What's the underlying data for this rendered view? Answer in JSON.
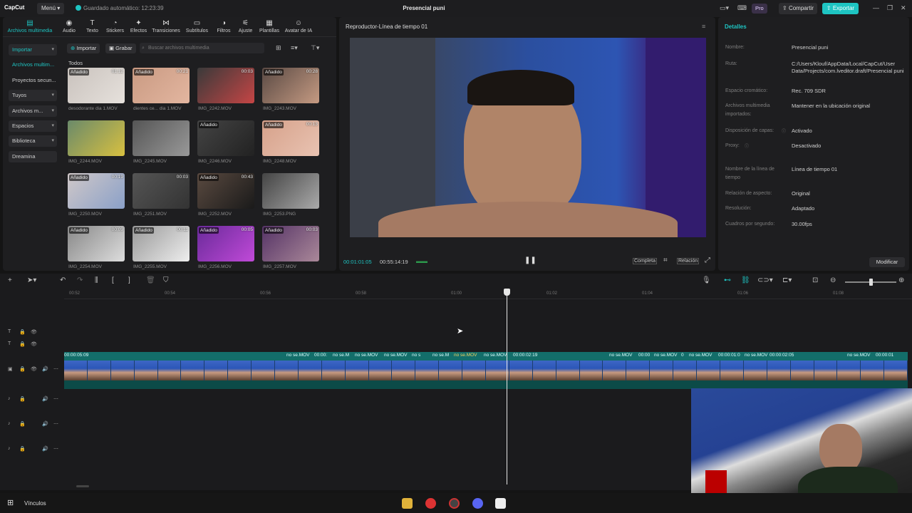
{
  "app": {
    "logo": "CapCut",
    "menu_label": "Menú",
    "autosave": "Guardado automático: 12:23:39",
    "project_title": "Presencial puni",
    "pro_label": "Pro",
    "share_label": "Compartir",
    "export_label": "Exportar"
  },
  "toolbar": {
    "tools": [
      {
        "label": "Archivos multimedia",
        "icon": "media-icon"
      },
      {
        "label": "Audio",
        "icon": "audio-icon"
      },
      {
        "label": "Texto",
        "icon": "text-icon"
      },
      {
        "label": "Stickers",
        "icon": "sticker-icon"
      },
      {
        "label": "Efectos",
        "icon": "effects-icon"
      },
      {
        "label": "Transiciones",
        "icon": "transitions-icon"
      },
      {
        "label": "Subtítulos",
        "icon": "subtitles-icon"
      },
      {
        "label": "Filtros",
        "icon": "filters-icon"
      },
      {
        "label": "Ajuste",
        "icon": "adjust-icon"
      },
      {
        "label": "Plantillas",
        "icon": "templates-icon"
      },
      {
        "label": "Avatar de IA",
        "icon": "ai-avatar-icon"
      }
    ]
  },
  "sidebar": {
    "items": [
      {
        "label": "Importar"
      },
      {
        "label": "Archivos multim..."
      },
      {
        "label": "Proyectos secun..."
      },
      {
        "label": "Tuyos"
      },
      {
        "label": "Archivos m..."
      },
      {
        "label": "Espacios"
      },
      {
        "label": "Biblioteca"
      },
      {
        "label": "Dreamina"
      }
    ]
  },
  "media": {
    "import_label": "Importar",
    "record_label": "Grabar",
    "search_placeholder": "Buscar archivos multimedia",
    "section_label": "Todos",
    "added_label": "Añadido",
    "items": [
      {
        "name": "desodorante dia 1.MOV",
        "duration": "01:12",
        "added": true
      },
      {
        "name": "dientes ce... dia 1.MOV",
        "duration": "00:21",
        "added": true
      },
      {
        "name": "IMG_2242.MOV",
        "duration": "00:03",
        "added": false
      },
      {
        "name": "IMG_2243.MOV",
        "duration": "00:28",
        "added": true
      },
      {
        "name": "IMG_2244.MOV",
        "duration": "",
        "added": false
      },
      {
        "name": "IMG_2245.MOV",
        "duration": "",
        "added": false
      },
      {
        "name": "IMG_2246.MOV",
        "duration": "",
        "added": true
      },
      {
        "name": "IMG_2248.MOV",
        "duration": "00:13",
        "added": true
      },
      {
        "name": "IMG_2250.MOV",
        "duration": "00:19",
        "added": true
      },
      {
        "name": "IMG_2251.MOV",
        "duration": "00:03",
        "added": false
      },
      {
        "name": "IMG_2252.MOV",
        "duration": "00:43",
        "added": true
      },
      {
        "name": "IMG_2253.PNG",
        "duration": "",
        "added": false
      },
      {
        "name": "IMG_2254.MOV",
        "duration": "00:09",
        "added": true
      },
      {
        "name": "IMG_2255.MOV",
        "duration": "00:11",
        "added": true
      },
      {
        "name": "IMG_2256.MOV",
        "duration": "00:05",
        "added": true
      },
      {
        "name": "IMG_2257.MOV",
        "duration": "00:03",
        "added": true
      }
    ]
  },
  "player": {
    "title": "Reproductor-Línea de tiempo 01",
    "current_time": "00:01:01:05",
    "total_time": "00:55:14:19",
    "full_label": "Completa",
    "ratio_label": "Relación"
  },
  "details": {
    "header": "Detalles",
    "rows": [
      {
        "label": "Nombre:",
        "value": "Presencial puni"
      },
      {
        "label": "Ruta:",
        "value": "C:/Users/Klouf/AppData/Local/CapCut/User Data/Projects/com.lveditor.draft/Presencial puni"
      },
      {
        "label": "Espacio cromático:",
        "value": "Rec. 709 SDR"
      },
      {
        "label": "Archivos multimedia importados:",
        "value": "Mantener en la ubicación original"
      },
      {
        "label": "Disposición de capas:",
        "value": "Activado"
      },
      {
        "label": "Proxy:",
        "value": "Desactivado"
      },
      {
        "label": "Nombre de la línea de tiempo",
        "value": "Línea de tiempo 01"
      },
      {
        "label": "Relación de aspecto:",
        "value": "Original"
      },
      {
        "label": "Resolución:",
        "value": "Adaptado"
      },
      {
        "label": "Cuadros por segundo:",
        "value": "30.00fps"
      }
    ],
    "modify_label": "Modificar"
  },
  "timeline": {
    "ruler_ticks": [
      "00:52",
      "00:54",
      "00:56",
      "00:58",
      "01:00",
      "01:02",
      "01:04",
      "01:06",
      "01:08"
    ],
    "clip_labels": [
      "00:00:05:09",
      "no se.MOV",
      "00:00:",
      "no se.M",
      "no se.MOV",
      "no se.MOV",
      "no s",
      "no se.M",
      "no se.MOV",
      "no se.MOV",
      "00:00:02:19",
      "no se.MOV",
      "00:00",
      "no se.MOV",
      "0",
      "no se.MOV",
      "00:00:01:0",
      "no se.MOV",
      "00:00:02:05",
      "no se.MOV",
      "00:00:01"
    ]
  },
  "taskbar": {
    "search_label": "Vínculos"
  },
  "colors": {
    "accent": "#1ec4c2",
    "clip": "#0f5d5a",
    "panel": "#1e1e20"
  }
}
